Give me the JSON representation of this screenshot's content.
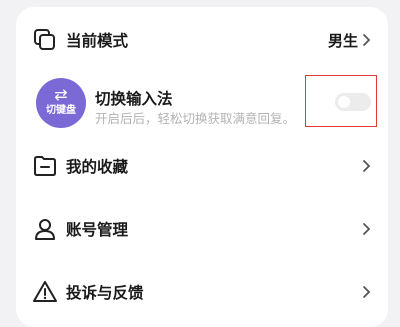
{
  "mode_row": {
    "label": "当前模式",
    "value": "男生",
    "icon": "copy-icon"
  },
  "ime_row": {
    "badge_text": "切键盘",
    "badge_icon": "swap-arrows-icon",
    "title": "切换输入法",
    "description": "开启后后，轻松切换获取满意回复。",
    "toggle_on": false,
    "badge_color": "#7b6ad6"
  },
  "menu": [
    {
      "label": "我的收藏",
      "icon": "folder-icon"
    },
    {
      "label": "账号管理",
      "icon": "user-icon"
    },
    {
      "label": "投诉与反馈",
      "icon": "warning-icon"
    }
  ],
  "colors": {
    "highlight": "#e53935",
    "toggle_off": "#ececec"
  }
}
